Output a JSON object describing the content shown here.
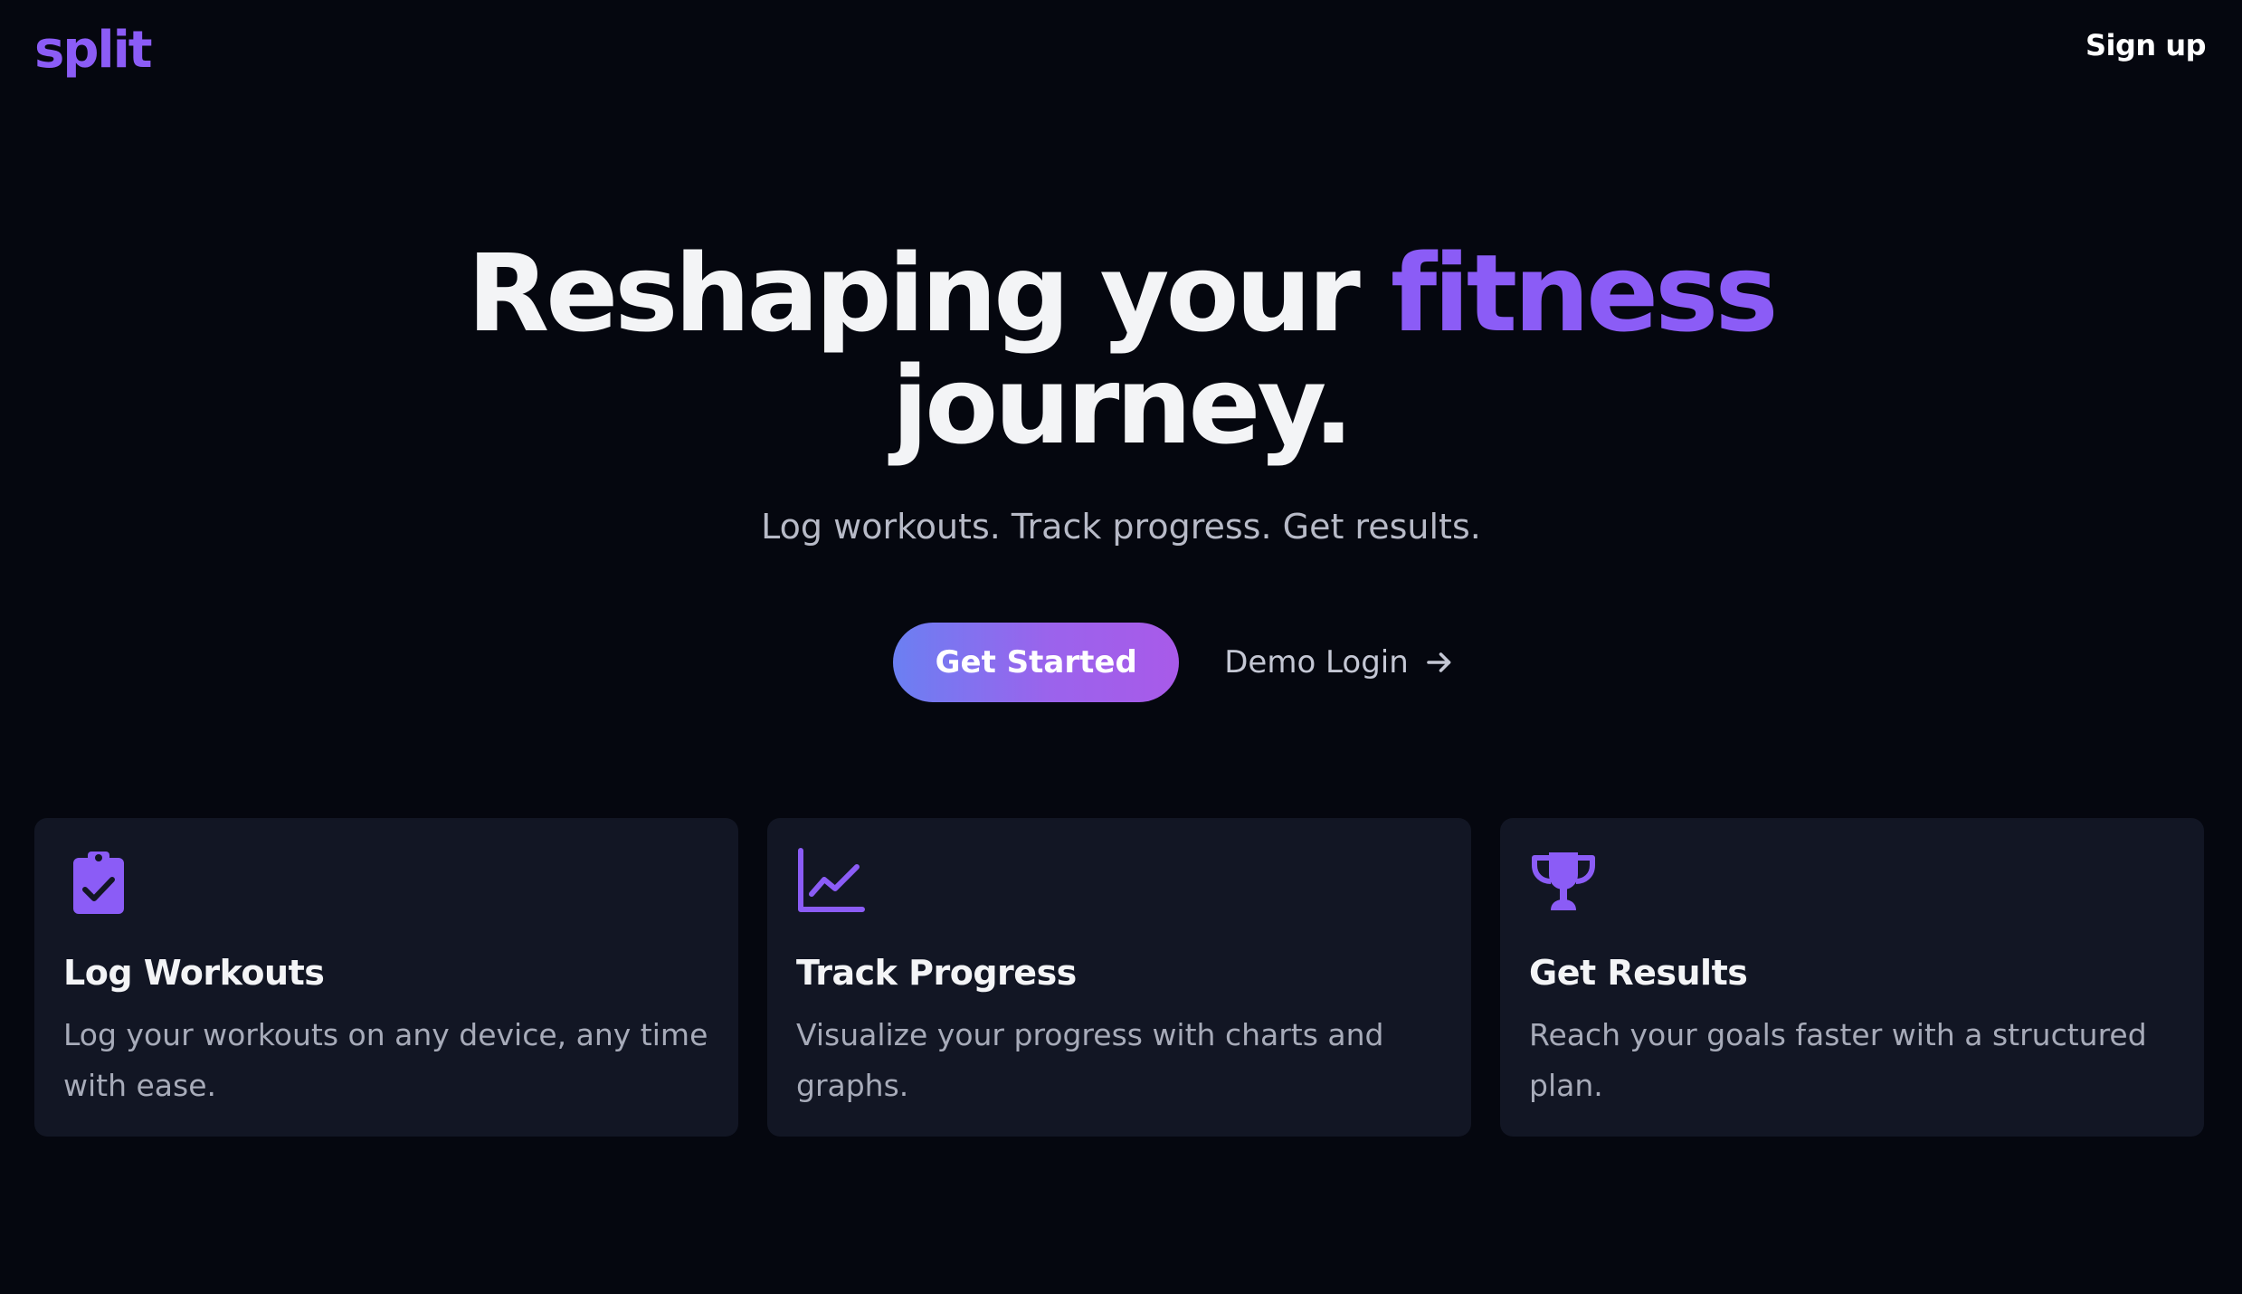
{
  "header": {
    "logo": "split",
    "signup_label": "Sign up"
  },
  "hero": {
    "headline_part1": "Reshaping your",
    "headline_accent": "fitness",
    "headline_part2": "journey.",
    "tagline": "Log workouts. Track progress. Get results."
  },
  "cta": {
    "primary_label": "Get Started",
    "secondary_label": "Demo Login",
    "secondary_icon": "arrow-right-icon"
  },
  "features": [
    {
      "icon": "clipboard-check-icon",
      "title": "Log Workouts",
      "description": "Log your workouts on any device, any time with ease."
    },
    {
      "icon": "chart-line-icon",
      "title": "Track Progress",
      "description": "Visualize your progress with charts and graphs."
    },
    {
      "icon": "trophy-icon",
      "title": "Get Results",
      "description": "Reach your goals faster with a structured plan."
    }
  ],
  "colors": {
    "background": "#05070f",
    "accent": "#8b5cf6",
    "card_background": "#121624",
    "button_gradient_start": "#6b7ff2",
    "button_gradient_end": "#a85ae9"
  }
}
